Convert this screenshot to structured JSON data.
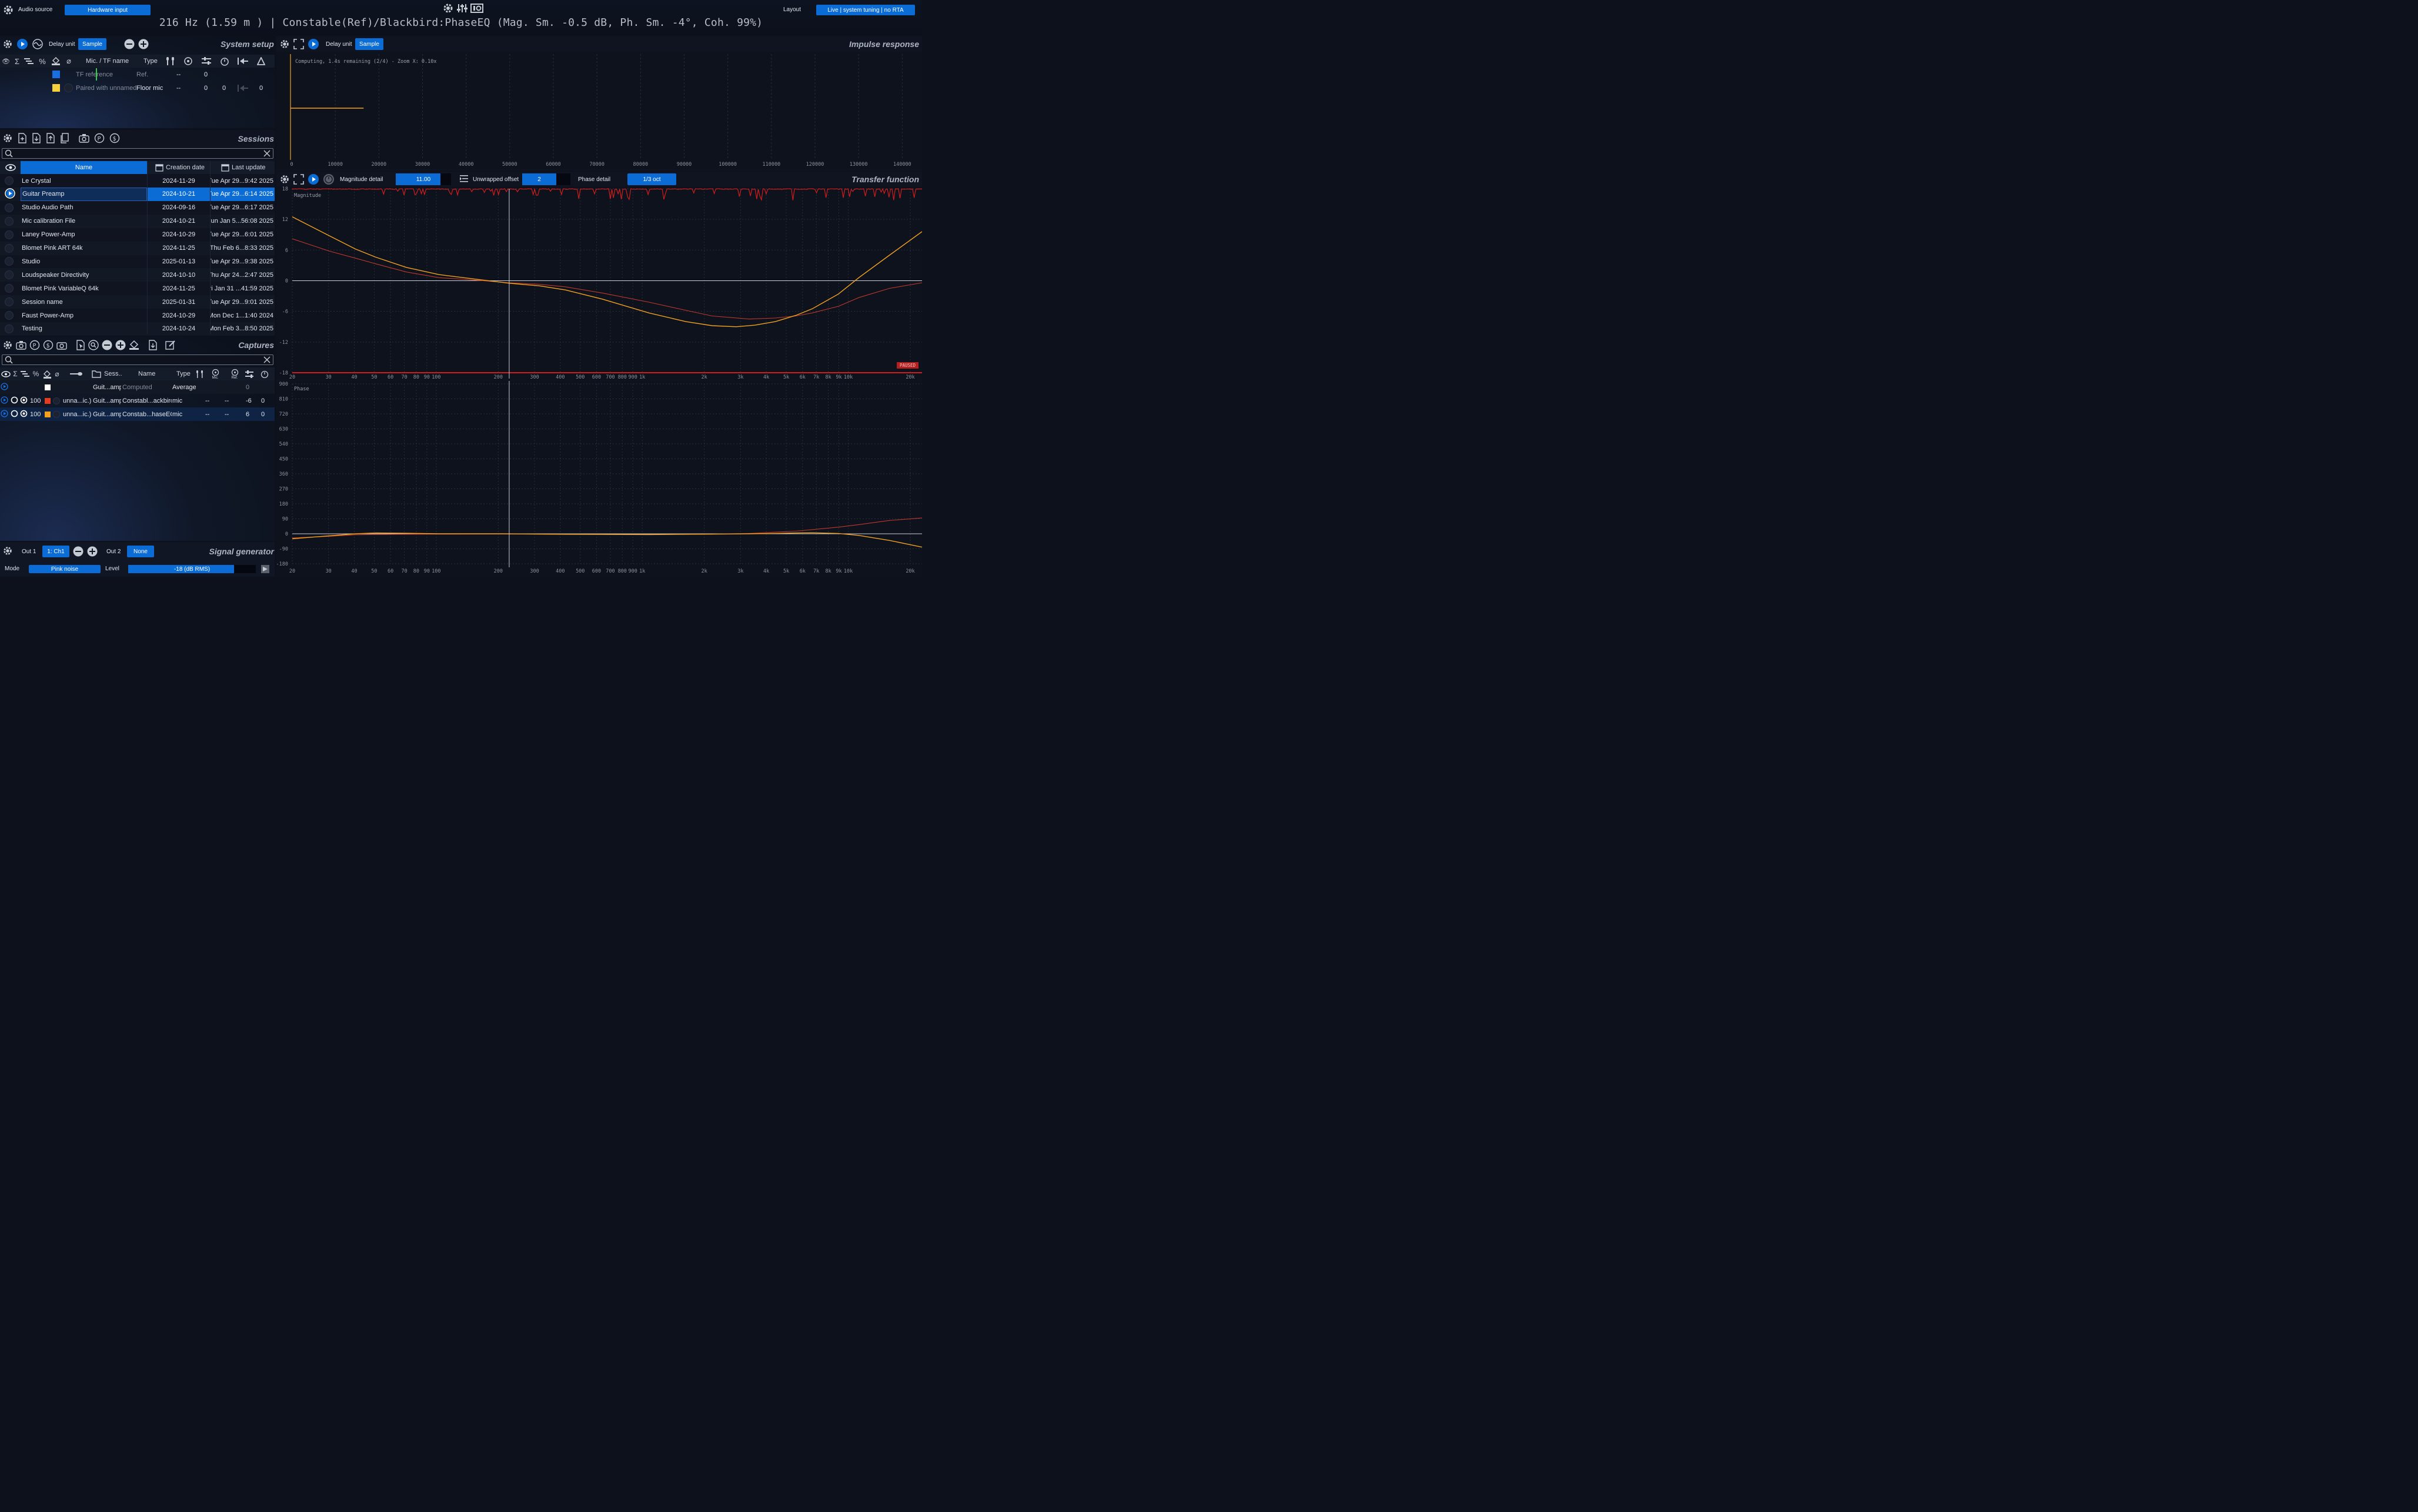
{
  "topbar": {
    "audio_source_label": "Audio source",
    "audio_source_value": "Hardware input",
    "layout_label": "Layout",
    "layout_value": "Live | system tuning | no RTA",
    "status_line": "216 Hz (1.59 m ) | Constable(Ref)/Blackbird:PhaseEQ (Mag. Sm.  -0.5 dB, Ph. Sm.    -4°, Coh.  99%)"
  },
  "system_setup": {
    "title": "System setup",
    "delay_unit_label": "Delay unit",
    "delay_unit_value": "Sample",
    "columns": [
      "Mic. / TF name",
      "Type"
    ],
    "rows": [
      {
        "name": "TF reference",
        "type": "Ref.",
        "c1": "--",
        "c2": "0",
        "c3": "",
        "c4": "",
        "color": "#1a6fe0"
      },
      {
        "name": "Paired with unnamed",
        "type": "Floor mic",
        "c1": "--",
        "c2": "0",
        "c3": "0",
        "c4": "0",
        "color": "#f4d13d"
      }
    ]
  },
  "sessions": {
    "title": "Sessions",
    "search_placeholder": "",
    "columns": {
      "name": "Name",
      "created": "Creation date",
      "updated": "Last update"
    },
    "rows": [
      {
        "name": "Le Crystal",
        "created": "2024-11-29",
        "updated": "Tue Apr 29...9:42 2025"
      },
      {
        "name": "Guitar Preamp",
        "created": "2024-10-21",
        "updated": "Tue Apr 29...6:14 2025"
      },
      {
        "name": "Studio Audio Path",
        "created": "2024-09-16",
        "updated": "Tue Apr 29...6:17 2025"
      },
      {
        "name": "Mic calibration File",
        "created": "2024-10-21",
        "updated": "Sun Jan  5...56:08 2025"
      },
      {
        "name": "Laney Power-Amp",
        "created": "2024-10-29",
        "updated": "Tue Apr 29...6:01 2025"
      },
      {
        "name": "Blomet Pink ART 64k",
        "created": "2024-11-25",
        "updated": "Thu Feb  6...8:33 2025"
      },
      {
        "name": "Studio",
        "created": "2025-01-13",
        "updated": "Tue Apr 29...9:38 2025"
      },
      {
        "name": "Loudspeaker Directivity",
        "created": "2024-10-10",
        "updated": "Thu Apr 24...2:47 2025"
      },
      {
        "name": "Blomet Pink VariableQ 64k",
        "created": "2024-11-25",
        "updated": "Fri Jan 31 ...41:59 2025"
      },
      {
        "name": "Session name",
        "created": "2025-01-31",
        "updated": "Tue Apr 29...9:01 2025"
      },
      {
        "name": "Faust Power-Amp",
        "created": "2024-10-29",
        "updated": "Mon Dec 1...1:40 2024"
      },
      {
        "name": "Testing",
        "created": "2024-10-24",
        "updated": "Mon Feb  3...8:50 2025"
      }
    ]
  },
  "captures": {
    "title": "Captures",
    "columns": {
      "session": "Sess...",
      "name": "Name",
      "type": "Type",
      "mic": "Mic.",
      "ref": "Ref."
    },
    "rows": [
      {
        "pct": "",
        "color": "#ffffff",
        "mic": "",
        "session": "Guit...amp",
        "name": "Computed",
        "type": "Average",
        "a": "",
        "b": "",
        "offset": "0",
        "delay": ""
      },
      {
        "pct": "100",
        "color": "#e53b1f",
        "mic": "unna...ic.)",
        "session": "Guit...amp",
        "name": "Constabl...ackbird",
        "type": "mic",
        "a": "--",
        "b": "--",
        "offset": "-6",
        "delay": "0"
      },
      {
        "pct": "100",
        "color": "#f2a11e",
        "mic": "unna...ic.)",
        "session": "Guit...amp",
        "name": "Constab...haseEQ",
        "type": "mic",
        "a": "--",
        "b": "--",
        "offset": "6",
        "delay": "0"
      }
    ]
  },
  "signal_generator": {
    "title": "Signal generator",
    "out1_label": "Out 1",
    "out1_value": "1: Ch1",
    "out2_label": "Out 2",
    "out2_value": "None",
    "mode_label": "Mode",
    "mode_value": "Pink noise",
    "level_label": "Level",
    "level_value": "-18 (dB RMS)",
    "level_fraction": 0.83
  },
  "impulse": {
    "title": "Impulse response",
    "delay_unit_label": "Delay unit",
    "delay_unit_value": "Sample",
    "status": "Computing, 1.4s remaining (2/4) - Zoom X: 0.10x",
    "x_ticks": [
      "0",
      "10000",
      "20000",
      "30000",
      "40000",
      "50000",
      "60000",
      "70000",
      "80000",
      "90000",
      "100000",
      "110000",
      "120000",
      "130000",
      "140000"
    ]
  },
  "transfer": {
    "title": "Transfer function",
    "magnitude_detail_label": "Magnitude detail",
    "magnitude_detail_value": "11.00",
    "unwrapped_offset_label": "Unwrapped offset",
    "unwrapped_offset_value": "2",
    "phase_detail_label": "Phase detail",
    "phase_detail_value": "1/3 oct",
    "magnitude_label": "Magnitude",
    "phase_label": "Phase",
    "paused_badge": "PAUSED",
    "mag_y_ticks": [
      "18",
      "12",
      "6",
      "0",
      "-6",
      "-12",
      "-18"
    ],
    "phase_y_ticks": [
      "900",
      "810",
      "720",
      "630",
      "540",
      "450",
      "360",
      "270",
      "180",
      "90",
      "0",
      "-90",
      "-180"
    ],
    "freq_ticks": [
      "20",
      "30",
      "40",
      "50",
      "60",
      "70",
      "80",
      "90",
      "100",
      "200",
      "300",
      "400",
      "500",
      "600",
      "700",
      "800",
      "900",
      "1k",
      "2k",
      "3k",
      "4k",
      "5k",
      "6k",
      "7k",
      "8k",
      "9k",
      "10k",
      "20k"
    ],
    "cursor_hz": 216
  },
  "colors": {
    "accent": "#0b6cd6",
    "trace_orange": "#f2a11e",
    "trace_red": "#e53b1f",
    "coherence_red": "#d11d1d"
  }
}
